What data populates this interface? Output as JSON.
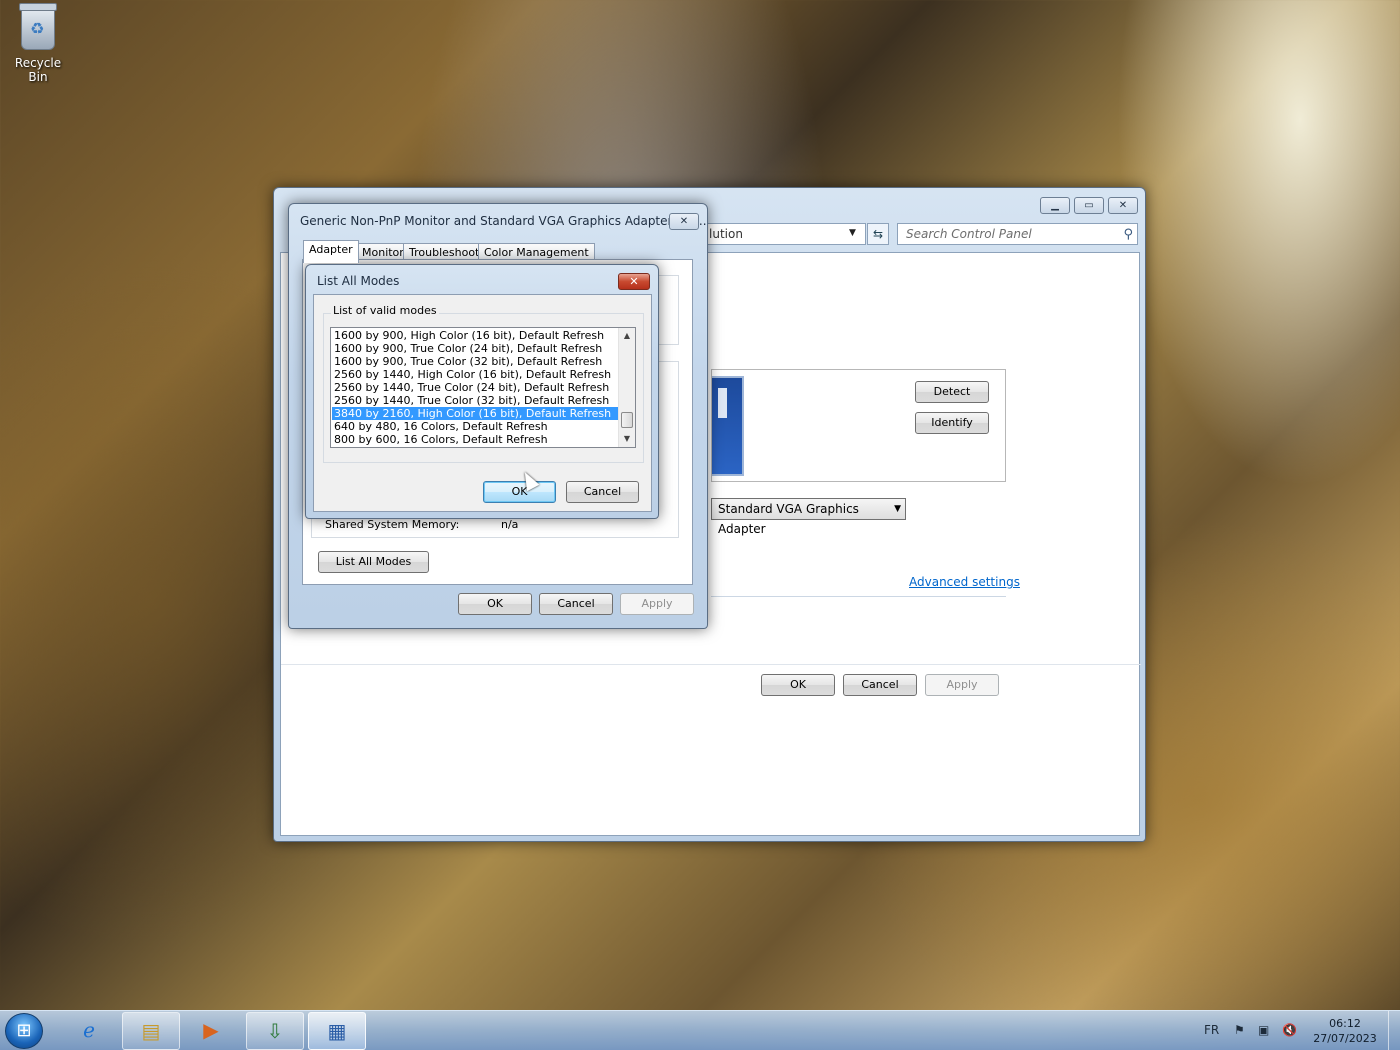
{
  "desktop": {
    "recycle_bin_label": "Recycle Bin"
  },
  "control_panel": {
    "address_text": "lution",
    "search_placeholder": "Search Control Panel",
    "detect_label": "Detect",
    "identify_label": "Identify",
    "adapter_select_value": "Standard VGA Graphics Adapter",
    "advanced_settings_link": "Advanced settings",
    "ok_label": "OK",
    "cancel_label": "Cancel",
    "apply_label": "Apply"
  },
  "adapter_properties": {
    "title": "Generic Non-PnP Monitor and Standard VGA Graphics Adapter Pro...",
    "tabs": [
      "Adapter",
      "Monitor",
      "Troubleshoot",
      "Color Management"
    ],
    "shared_system_memory_label": "Shared System Memory:",
    "shared_system_memory_value": "n/a",
    "list_all_modes_label": "List All Modes",
    "ok_label": "OK",
    "cancel_label": "Cancel",
    "apply_label": "Apply"
  },
  "list_all_modes": {
    "title": "List All Modes",
    "group_label": "List of valid modes",
    "modes": [
      "1600 by 900, High Color (16 bit), Default Refresh",
      "1600 by 900, True Color (24 bit), Default Refresh",
      "1600 by 900, True Color (32 bit), Default Refresh",
      "2560 by 1440, High Color (16 bit), Default Refresh",
      "2560 by 1440, True Color (24 bit), Default Refresh",
      "2560 by 1440, True Color (32 bit), Default Refresh",
      "3840 by 2160, High Color (16 bit), Default Refresh",
      "640 by 480, 16 Colors, Default Refresh",
      "800 by 600, 16 Colors, Default Refresh"
    ],
    "selected_index": 6,
    "ok_label": "OK",
    "cancel_label": "Cancel"
  },
  "taskbar": {
    "language": "FR",
    "time": "06:12",
    "date": "27/07/2023",
    "apps": [
      "start-icon",
      "internet-explorer-icon",
      "file-explorer-icon",
      "media-player-icon",
      "network-app-icon",
      "control-panel-icon"
    ]
  },
  "colors": {
    "selection": "#3399ff",
    "link": "#0066cc",
    "close_button": "#c84a30"
  }
}
